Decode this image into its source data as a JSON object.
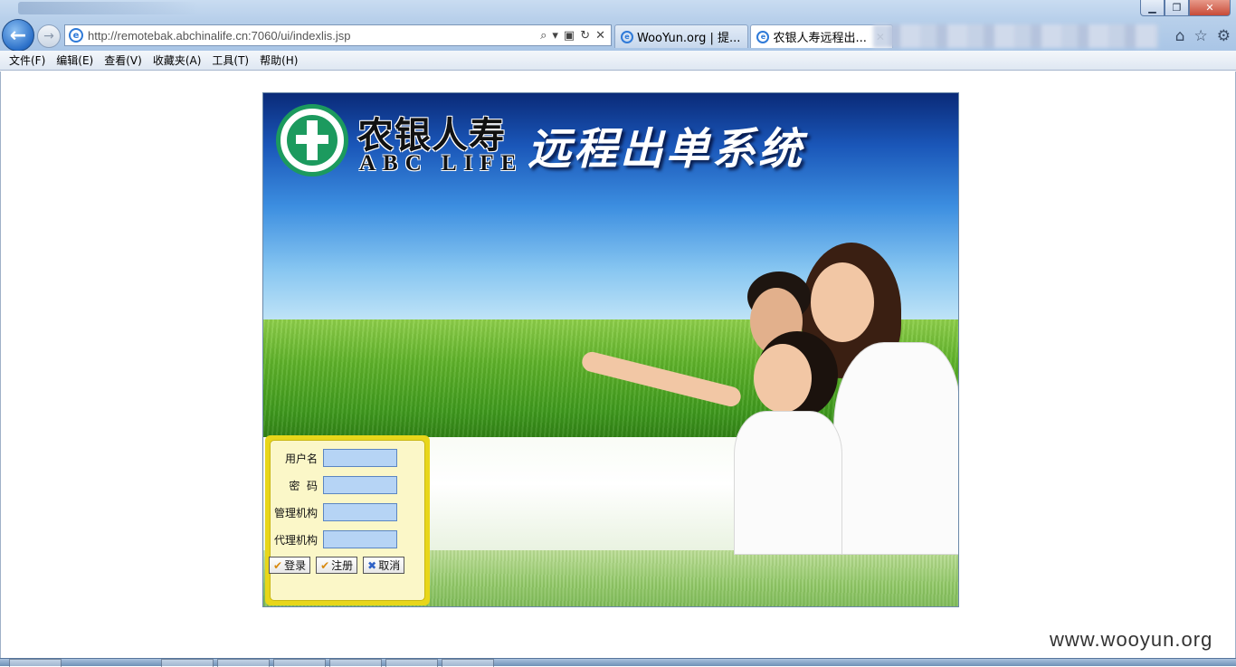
{
  "browser": {
    "address_url": "http://remotebak.abchinalife.cn:7060/ui/indexlis.jsp",
    "tabs": [
      {
        "label": "WooYun.org | 提...",
        "active": false
      },
      {
        "label": "农银人寿远程出...",
        "active": true
      }
    ],
    "window_buttons": {
      "minimize": "▁",
      "restore": "❐",
      "close": "✕"
    }
  },
  "menu": {
    "items": [
      "文件(F)",
      "编辑(E)",
      "查看(V)",
      "收藏夹(A)",
      "工具(T)",
      "帮助(H)"
    ]
  },
  "banner": {
    "brand_cn": "农银人寿",
    "brand_en": "ABC LIFE",
    "system_title": "远程出单系统"
  },
  "login": {
    "username_label": "用户名",
    "password_label": "密  码",
    "manage_org_label": "管理机构",
    "agent_org_label": "代理机构",
    "username_value": "",
    "password_value": "",
    "manage_org_value": "",
    "agent_org_value": "",
    "login_button": "登录",
    "register_button": "注册",
    "cancel_button": "取消"
  },
  "watermark": "www.wooyun.org",
  "colors": {
    "login_frame": "#e8d61a",
    "input_bg": "#b6d4f5",
    "logo_green": "#1c9a5e"
  }
}
